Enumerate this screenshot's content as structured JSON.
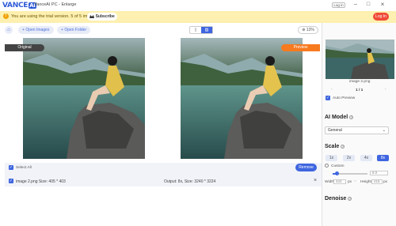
{
  "app": {
    "logo_text": "VANCE",
    "logo_ai": "AI",
    "title": "VanceAI PC - Enlarge",
    "login": "Log in"
  },
  "banner": {
    "message": "You are using the trial version. 5 of 5 images left",
    "subscribe": "Subscribe",
    "login": "Log In"
  },
  "toolbar": {
    "open_images": "Open Images",
    "open_folder": "Open Folder",
    "zoom": "13%"
  },
  "labels": {
    "original": "Original",
    "preview": "Preview"
  },
  "list": {
    "select_all": "Select All",
    "remove": "Remove",
    "file": {
      "name_size": "image 2.png  Size: 405 * 403",
      "output": "Output: 8x, Size: 3240 * 3224"
    }
  },
  "sidebar": {
    "thumb_name": "image 2.png",
    "pager": "1 / 1",
    "auto_preview": "Auto Preview",
    "ai_model_title": "AI Model",
    "ai_model_value": "General",
    "scale_title": "Scale",
    "scales": [
      "1x",
      "2x",
      "4x",
      "8x"
    ],
    "custom_label": "Custom",
    "custom_value": "8.0",
    "width_label": "Width",
    "width_value": "424",
    "px1": "px",
    "height_label": "Height",
    "height_value": "416",
    "px2": "px",
    "denoise_title": "Denoise"
  },
  "colors": {
    "accent": "#3f66e0",
    "preview": "#f77a1f",
    "banner": "#fdf0b0",
    "login": "#f04a36"
  },
  "icons": {
    "home": "home-icon",
    "add": "plus-icon",
    "warn": "warning-icon",
    "close": "close-icon",
    "zoom": "zoom-icon"
  }
}
